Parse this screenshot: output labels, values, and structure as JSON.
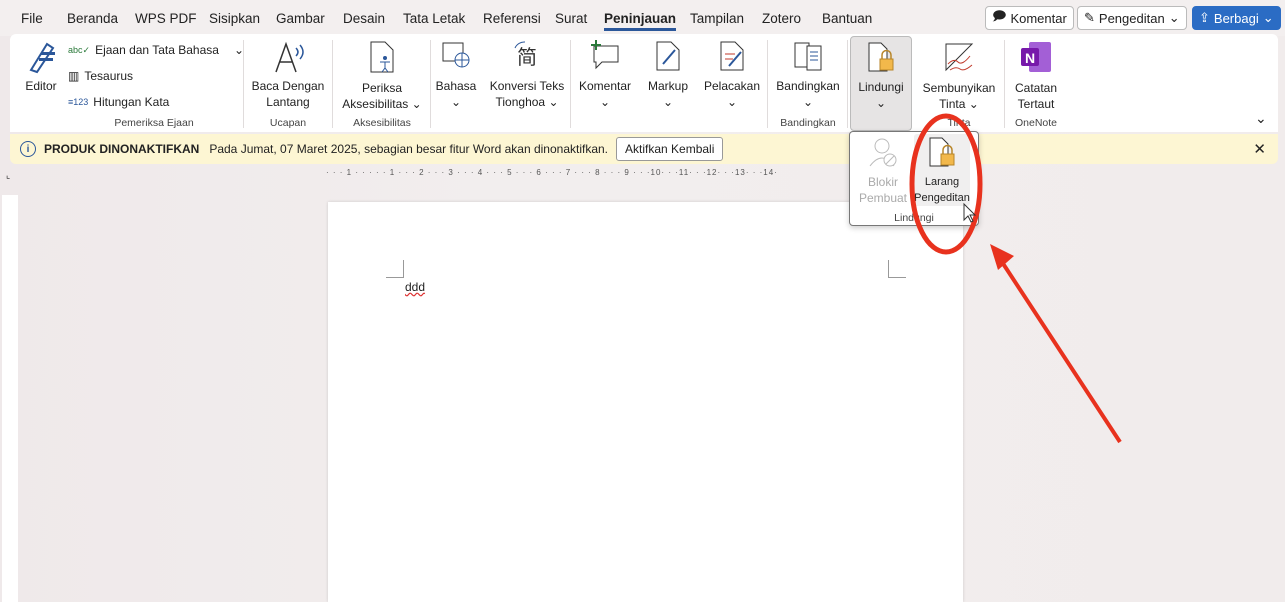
{
  "menu": [
    "File",
    "Beranda",
    "WPS PDF",
    "Sisipkan",
    "Gambar",
    "Desain",
    "Tata Letak",
    "Referensi",
    "Surat",
    "Peninjauan",
    "Tampilan",
    "Zotero",
    "Bantuan"
  ],
  "top_buttons": {
    "komentar": "Komentar",
    "pengeditan": "Pengeditan",
    "berbagi": "Berbagi"
  },
  "ribbon": {
    "editor": "Editor",
    "ejaan": "Ejaan dan Tata Bahasa",
    "tesaurus": "Tesaurus",
    "hitungan": "Hitungan Kata",
    "baca1": "Baca Dengan",
    "baca2": "Lantang",
    "periksa1": "Periksa",
    "periksa2": "Aksesibilitas",
    "bahasa": "Bahasa",
    "konversi1": "Konversi Teks",
    "konversi2": "Tionghoa",
    "komentar": "Komentar",
    "markup": "Markup",
    "pelacakan": "Pelacakan",
    "bandingkan": "Bandingkan",
    "lindungi": "Lindungi",
    "sembunyikan1": "Sembunyikan",
    "sembunyikan2": "Tinta",
    "catatan1": "Catatan",
    "catatan2": "Tertaut",
    "groups": {
      "ejaan": "Pemeriksa Ejaan",
      "ucapan": "Ucapan",
      "aksesibilitas": "Aksesibilitas",
      "bandingkan": "Bandingkan",
      "tinta": "Tinta",
      "onenote": "OneNote"
    }
  },
  "infobar": {
    "title": "PRODUK DINONAKTIFKAN",
    "message": "Pada Jumat, 07 Maret 2025, sebagian besar fitur Word akan dinonaktifkan.",
    "button": "Aktifkan Kembali"
  },
  "ruler": "· · · 1 · · · · · 1 · · · 2 · · · 3 · · · 4 · · · 5 · · · 6 · · · 7 · · · 8 · · · 9 · · ·10· · ·11· · ·12· · ·13· · ·14·",
  "dropdown": {
    "blokir1": "Blokir",
    "blokir2": "Pembuat",
    "larang1": "Larang",
    "larang2": "Pengeditan",
    "group": "Lindungi"
  },
  "document": {
    "text": "ddd"
  },
  "colors": {
    "accent": "#2b579a",
    "annotation": "#e8321e",
    "info": "#fdf6d3"
  }
}
